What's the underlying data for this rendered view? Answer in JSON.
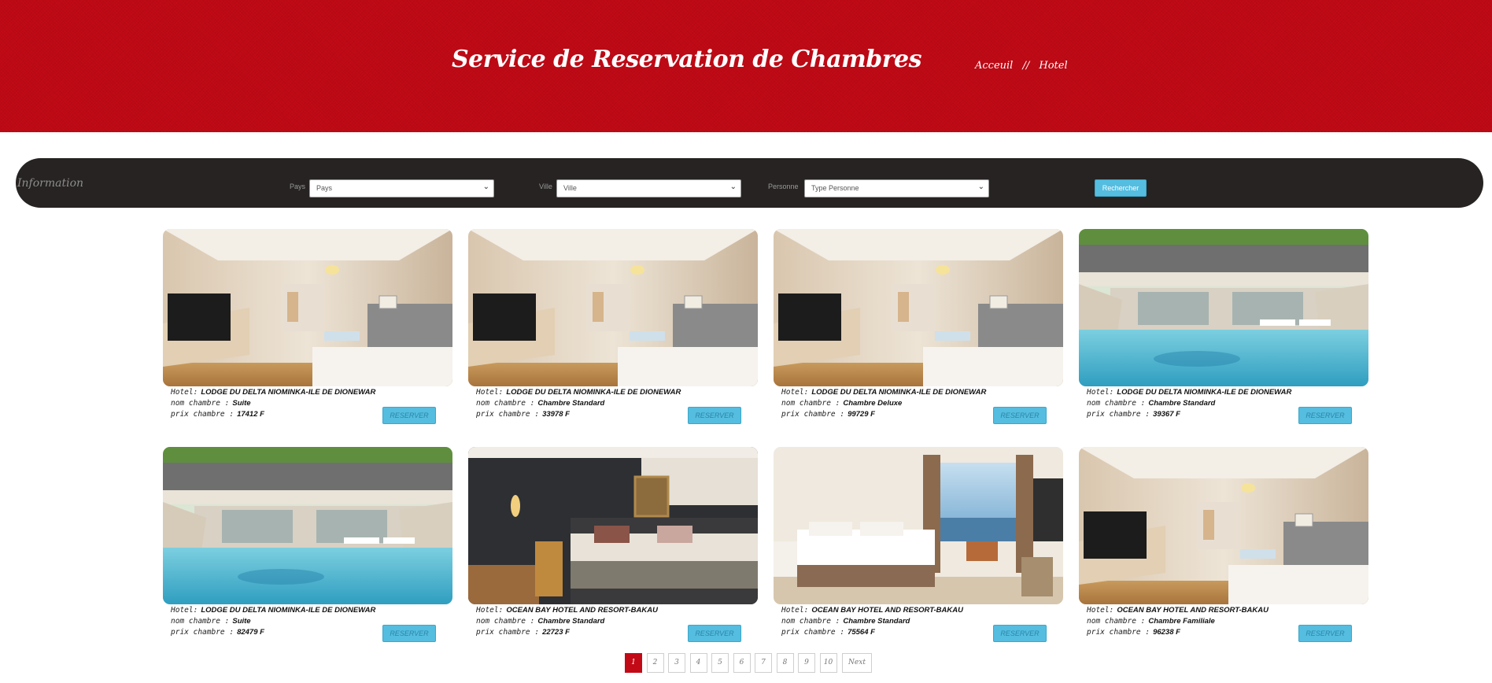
{
  "header": {
    "title": "Service de Reservation de Chambres",
    "breadcrumb": {
      "home": "Acceuil",
      "separator": "//",
      "current": "Hotel"
    },
    "background_color": "#c20a16"
  },
  "filters": {
    "section_title": "Information",
    "pays": {
      "label": "Pays",
      "selected": "Pays"
    },
    "ville": {
      "label": "Ville",
      "selected": "Ville"
    },
    "personne": {
      "label": "Personne",
      "selected": "Type Personne"
    },
    "search_label": "Rechercher"
  },
  "card_labels": {
    "hotel": "Hotel:",
    "room_name": "nom chambre :",
    "room_price": "prix chambre :",
    "reserve": "RESERVER"
  },
  "rooms": [
    {
      "hotel": "LODGE DU DELTA NIOMINKA-ILE DE DIONEWAR",
      "room": "Suite",
      "price": "17412 F",
      "image": "bright-room-with-tv"
    },
    {
      "hotel": "LODGE DU DELTA NIOMINKA-ILE DE DIONEWAR",
      "room": "Chambre Standard",
      "price": "33978 F",
      "image": "bright-room-with-tv"
    },
    {
      "hotel": "LODGE DU DELTA NIOMINKA-ILE DE DIONEWAR",
      "room": "Chambre Deluxe",
      "price": "99729 F",
      "image": "bright-room-with-tv"
    },
    {
      "hotel": "LODGE DU DELTA NIOMINKA-ILE DE DIONEWAR",
      "room": "Chambre Standard",
      "price": "39367 F",
      "image": "pool-terrace"
    },
    {
      "hotel": "LODGE DU DELTA NIOMINKA-ILE DE DIONEWAR",
      "room": "Suite",
      "price": "82479 F",
      "image": "pool-terrace"
    },
    {
      "hotel": "OCEAN BAY HOTEL AND RESORT-BAKAU",
      "room": "Chambre Standard",
      "price": "22723 F",
      "image": "dark-wall-room"
    },
    {
      "hotel": "OCEAN BAY HOTEL AND RESORT-BAKAU",
      "room": "Chambre Standard",
      "price": "75564 F",
      "image": "sea-view-room"
    },
    {
      "hotel": "OCEAN BAY HOTEL AND RESORT-BAKAU",
      "room": "Chambre Familiale",
      "price": "96238 F",
      "image": "bright-room-with-tv"
    }
  ],
  "pagination": {
    "pages": [
      "1",
      "2",
      "3",
      "4",
      "5",
      "6",
      "7",
      "8",
      "9",
      "10"
    ],
    "current": "1",
    "next_label": "Next"
  }
}
